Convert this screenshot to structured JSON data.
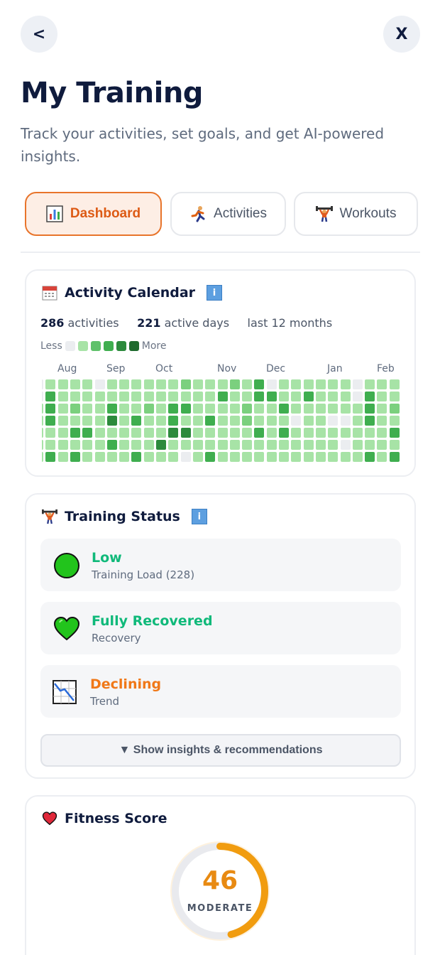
{
  "nav": {
    "back_label": "<",
    "close_label": "X"
  },
  "header": {
    "title": "My Training",
    "subtitle": "Track your activities, set goals, and get AI-powered insights."
  },
  "tabs": [
    {
      "label": "Dashboard",
      "icon": "bar-chart-icon",
      "active": true
    },
    {
      "label": "Activities",
      "icon": "runner-icon",
      "active": false
    },
    {
      "label": "Workouts",
      "icon": "weightlifter-icon",
      "active": false
    }
  ],
  "activity_calendar": {
    "title": "Activity Calendar",
    "info_label": "i",
    "activities_count": "286",
    "activities_label": "activities",
    "active_days_count": "221",
    "active_days_label": "active days",
    "period": "last 12 months",
    "legend_less": "Less",
    "legend_more": "More",
    "months": [
      "Aug",
      "Sep",
      "Oct",
      "Nov",
      "Dec",
      "Jan",
      "Feb"
    ],
    "colors": [
      "#ebedf0",
      "#a7e3a6",
      "#7bd07e",
      "#3fae4f",
      "#2c8a3c",
      "#1f6a2e"
    ]
  },
  "training_status": {
    "title": "Training Status",
    "info_label": "i",
    "items": [
      {
        "label": "Low",
        "sub": "Training Load (228)",
        "color": "#10b97a",
        "icon": "green-circle-icon"
      },
      {
        "label": "Fully Recovered",
        "sub": "Recovery",
        "color": "#10b97a",
        "icon": "green-heart-icon"
      },
      {
        "label": "Declining",
        "sub": "Trend",
        "color": "#f07818",
        "icon": "chart-decreasing-icon"
      }
    ],
    "insights_button": "▼ Show insights & recommendations"
  },
  "fitness_score": {
    "title": "Fitness Score",
    "value": "46",
    "label": "MODERATE",
    "fraction": 0.46,
    "accent": "#f19c0f"
  }
}
